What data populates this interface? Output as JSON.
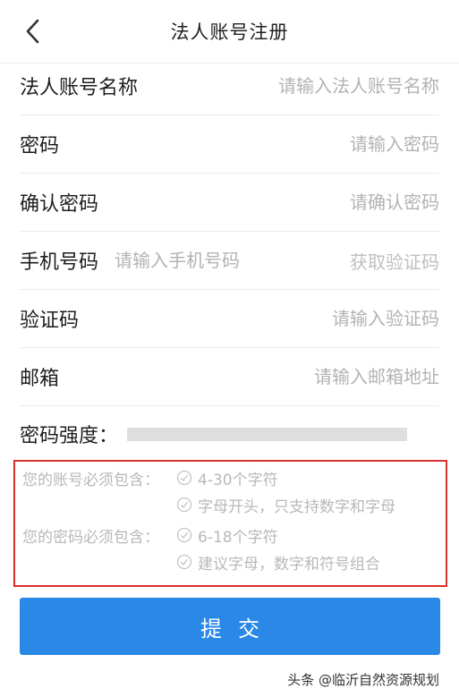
{
  "header": {
    "title": "法人账号注册"
  },
  "form": {
    "account_name": {
      "label": "法人账号名称",
      "placeholder": "请输入法人账号名称"
    },
    "password": {
      "label": "密码",
      "placeholder": "请输入密码"
    },
    "confirm_password": {
      "label": "确认密码",
      "placeholder": "请确认密码"
    },
    "phone": {
      "label": "手机号码",
      "placeholder": "请输入手机号码",
      "sms_button": "获取验证码"
    },
    "verification_code": {
      "label": "验证码",
      "placeholder": "请输入验证码"
    },
    "email": {
      "label": "邮箱",
      "placeholder": "请输入邮箱地址"
    },
    "strength": {
      "label": "密码强度："
    }
  },
  "rules": {
    "account": {
      "label": "您的账号必须包含：",
      "items": [
        "4-30个字符",
        "字母开头，只支持数字和字母"
      ]
    },
    "password": {
      "label": "您的密码必须包含：",
      "items": [
        "6-18个字符",
        "建议字母，数字和符号组合"
      ]
    }
  },
  "submit": {
    "label": "提交"
  },
  "watermark": "头条 @临沂自然资源规划",
  "colors": {
    "primary": "#2a88e6",
    "highlight_border": "#d9312d",
    "hint": "#b8b8b8"
  }
}
